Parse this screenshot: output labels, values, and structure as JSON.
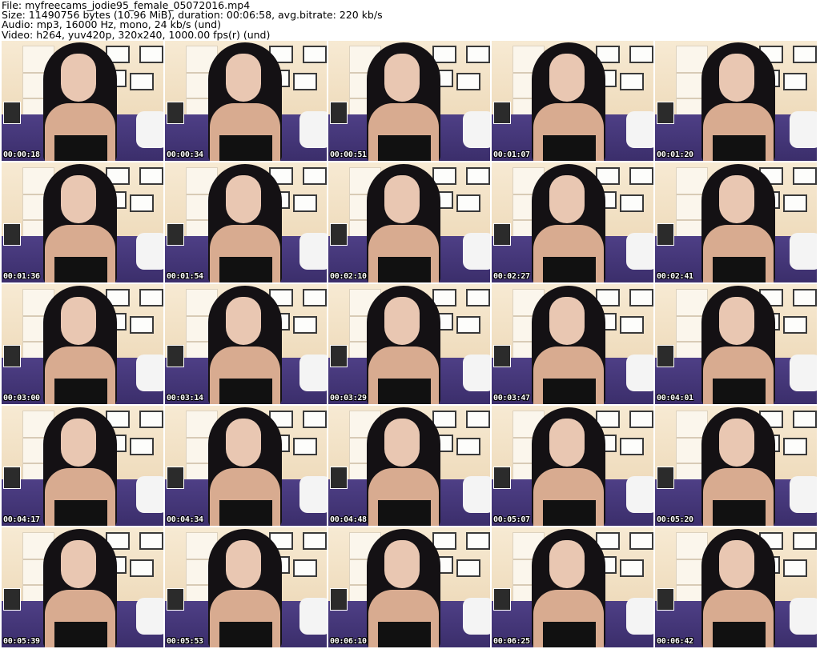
{
  "header": {
    "line1": "File: myfreecams_jodie95_female_05072016.mp4",
    "line2": "Size: 11490756 bytes (10.96 MiB), duration: 00:06:58, avg.bitrate: 220 kb/s",
    "line3": "Audio: mp3, 16000 Hz, mono, 24 kb/s (und)",
    "line4": "Video: h264, yuv420p, 320x240, 1000.00 fps(r) (und)"
  },
  "thumbnails": [
    "00:00:18",
    "00:00:34",
    "00:00:51",
    "00:01:07",
    "00:01:20",
    "00:01:36",
    "00:01:54",
    "00:02:10",
    "00:02:27",
    "00:02:41",
    "00:03:00",
    "00:03:14",
    "00:03:29",
    "00:03:47",
    "00:04:01",
    "00:04:17",
    "00:04:34",
    "00:04:48",
    "00:05:07",
    "00:05:20",
    "00:05:39",
    "00:05:53",
    "00:06:10",
    "00:06:25",
    "00:06:42"
  ]
}
